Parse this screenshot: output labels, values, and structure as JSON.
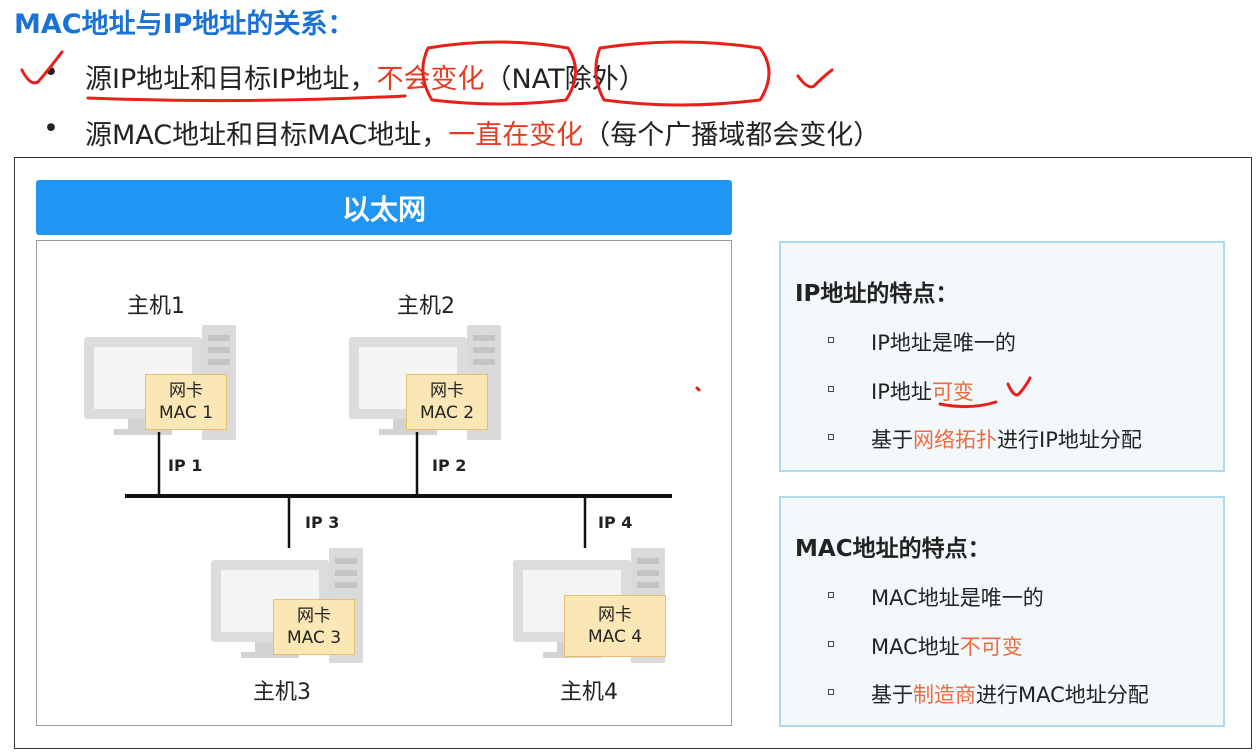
{
  "title": "MAC地址与IP地址的关系：",
  "bullets": [
    {
      "pre": "源IP地址和目标IP地址，",
      "hl": "不会变化",
      "post": "（NAT除外）"
    },
    {
      "pre": "源MAC地址和目标MAC地址，",
      "hl": "一直在变化",
      "post": "（每个广播域都会变化）"
    }
  ],
  "bullet_dot": "•",
  "ethernet": {
    "header": "以太网",
    "hosts": [
      {
        "label": "主机1",
        "nic_title": "网卡",
        "nic_mac": "MAC 1",
        "ip": "IP 1"
      },
      {
        "label": "主机2",
        "nic_title": "网卡",
        "nic_mac": "MAC 2",
        "ip": "IP 2"
      },
      {
        "label": "主机3",
        "nic_title": "网卡",
        "nic_mac": "MAC 3",
        "ip": "IP 3"
      },
      {
        "label": "主机4",
        "nic_title": "网卡",
        "nic_mac": "MAC 4",
        "ip": "IP 4"
      }
    ]
  },
  "ip_panel": {
    "title": "IP地址的特点：",
    "items": [
      {
        "pre": "IP地址是唯一的",
        "hl": "",
        "post": ""
      },
      {
        "pre": "IP地址",
        "hl": "可变",
        "post": ""
      },
      {
        "pre": "基于",
        "hl": "网络拓扑",
        "post": "进行IP地址分配"
      }
    ]
  },
  "mac_panel": {
    "title": "MAC地址的特点：",
    "items": [
      {
        "pre": "MAC地址是唯一的",
        "hl": "",
        "post": ""
      },
      {
        "pre": "MAC地址",
        "hl": "不可变",
        "post": ""
      },
      {
        "pre": "基于",
        "hl": "制造商",
        "post": "进行MAC地址分配"
      }
    ]
  },
  "colors": {
    "title_blue": "#1a72d6",
    "highlight_red": "#e23c21",
    "highlight_orange": "#ef6b3c",
    "header_blue": "#1f96f3",
    "nic_fill": "#fbe6b6",
    "annotation_red": "#e8201a"
  }
}
